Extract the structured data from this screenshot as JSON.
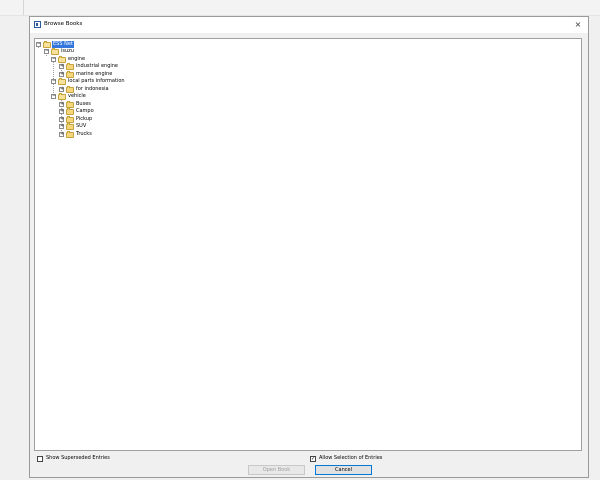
{
  "window": {
    "title": "Browse Books",
    "close_glyph": "×"
  },
  "tree": {
    "expand_glyph": "+",
    "collapse_glyph": "−",
    "nodes": [
      {
        "label": "ESS Net",
        "selected": true
      },
      {
        "label": "isuzu"
      },
      {
        "label": "engine"
      },
      {
        "label": "industrial engine"
      },
      {
        "label": "marine engine"
      },
      {
        "label": "local parts information"
      },
      {
        "label": "for indonesia"
      },
      {
        "label": "vehicle"
      },
      {
        "label": "Buses"
      },
      {
        "label": "Campo"
      },
      {
        "label": "Pickup"
      },
      {
        "label": "SUV"
      },
      {
        "label": "Trucks"
      }
    ]
  },
  "options": {
    "show_superseded": {
      "label": "Show Superseded Entries",
      "checked": false
    },
    "allow_selection": {
      "label": "Allow Selection of Entries",
      "checked": true
    }
  },
  "buttons": {
    "open": "Open Book",
    "cancel": "Cancel"
  },
  "check_glyph": "✓"
}
